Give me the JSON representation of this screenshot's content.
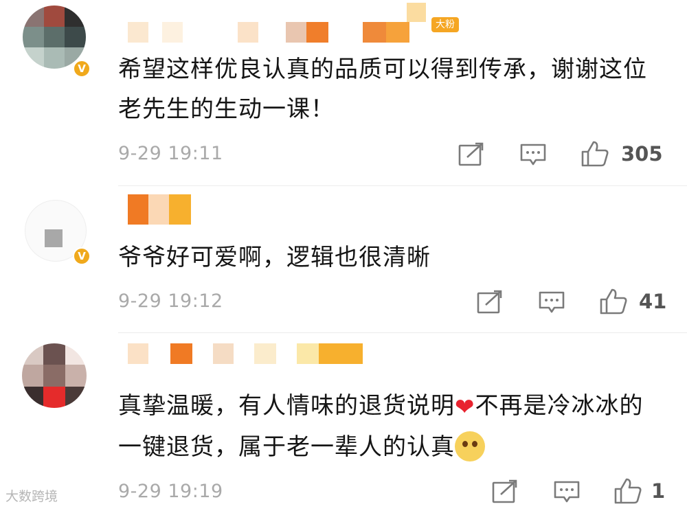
{
  "comments": [
    {
      "verified_badge": "V",
      "fan_badge": "大粉",
      "text": "希望这样优良认真的品质可以得到传承，谢谢这位老先生的生动一课！",
      "time": "9-29 19:11",
      "likes": "305"
    },
    {
      "verified_badge": "V",
      "text": "爷爷好可爱啊，逻辑也很清晰",
      "time": "9-29 19:12",
      "likes": "41"
    },
    {
      "text_before_emoji": "真挚温暖，有人情味的退货说明",
      "emoji_1": "red-heart",
      "text_after_emoji": "不再是冷冰冰的一键退货，属于老一辈人的认真",
      "emoji_2": "blushing-face",
      "time": "9-29 19:19",
      "likes": "1"
    }
  ],
  "watermark": "大数跨境",
  "colors": {
    "verified": "#f0a91c",
    "timestamp": "#a9a9a9",
    "like_count": "#555555",
    "icon_stroke": "#7a7a7a"
  }
}
